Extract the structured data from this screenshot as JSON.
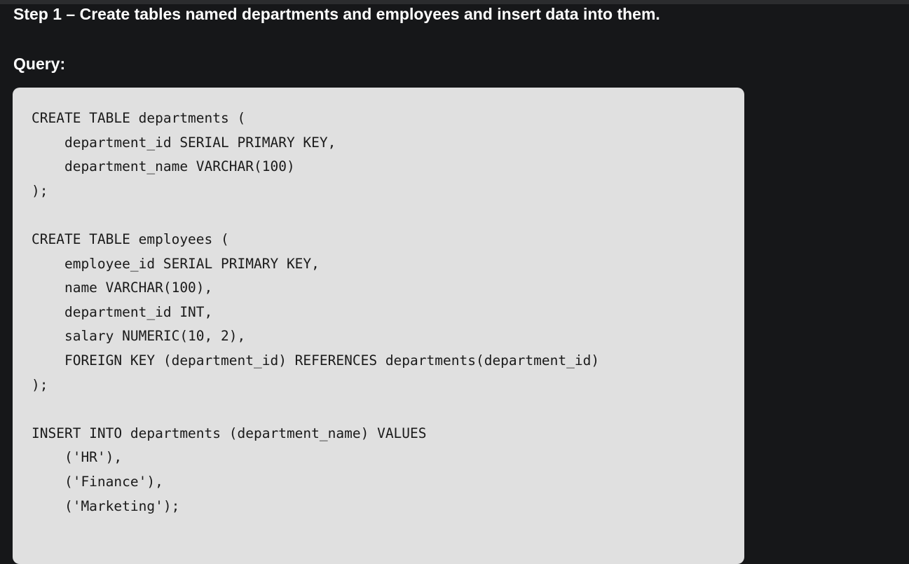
{
  "content": {
    "step_heading": "Step 1 – Create tables named departments and employees and insert data into them.",
    "query_label": "Query:",
    "code_lines": [
      "CREATE TABLE departments (",
      "    department_id SERIAL PRIMARY KEY,",
      "    department_name VARCHAR(100)",
      ");",
      "",
      "CREATE TABLE employees (",
      "    employee_id SERIAL PRIMARY KEY,",
      "    name VARCHAR(100),",
      "    department_id INT,",
      "    salary NUMERIC(10, 2),",
      "    FOREIGN KEY (department_id) REFERENCES departments(department_id)",
      ");",
      "",
      "INSERT INTO departments (department_name) VALUES",
      "    ('HR'),",
      "    ('Finance'),",
      "    ('Marketing');"
    ]
  },
  "colors": {
    "page_background": "#161719",
    "heading_text": "#ffffff",
    "code_background": "#e0e0e0",
    "code_text": "#1a1a1a"
  }
}
